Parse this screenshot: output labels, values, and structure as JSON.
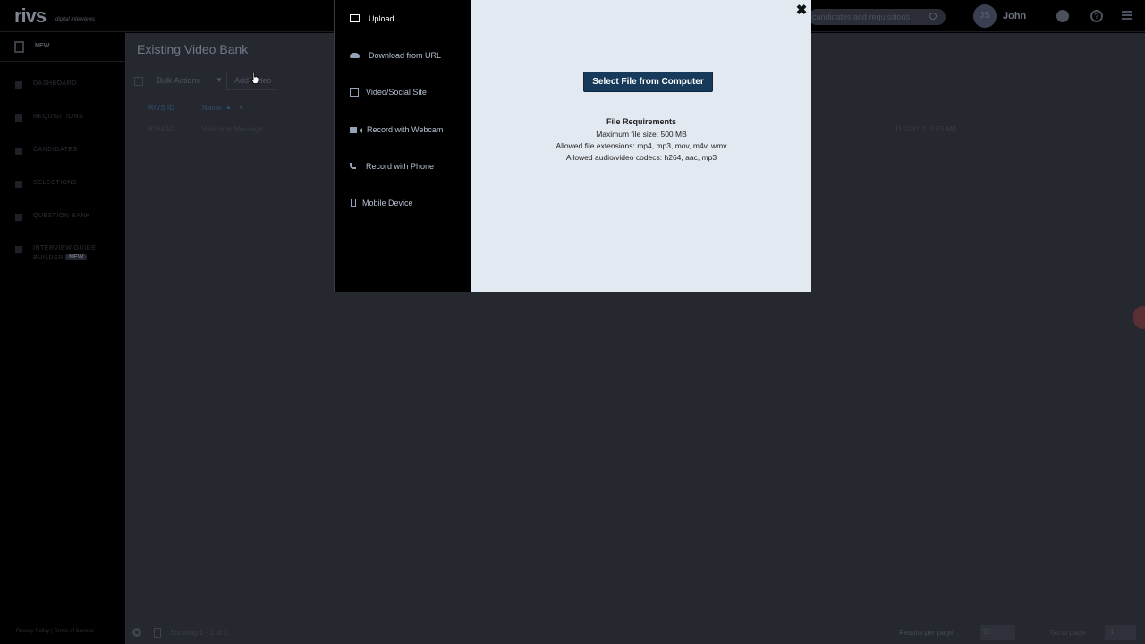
{
  "app": {
    "logo": "rivs",
    "logo_tagline": "digital interviews",
    "search_placeholder": "candidates and requisitions",
    "user": {
      "initials": "JS",
      "name": "John"
    }
  },
  "sidebar": {
    "new_label": "NEW",
    "items": [
      {
        "label": "DASHBOARD"
      },
      {
        "label": "REQUISITIONS"
      },
      {
        "label": "CANDIDATES"
      },
      {
        "label": "SELECTIONS"
      },
      {
        "label": "QUESTION BANK"
      },
      {
        "label": "INTERVIEW GUIDE",
        "label2": "BUILDER",
        "badge": "NEW"
      }
    ],
    "footer": "Privacy Policy | Terms of Service"
  },
  "main": {
    "title": "Existing Video Bank",
    "bulk_actions_label": "Bulk Actions",
    "add_button_label": "Add Video",
    "columns": {
      "id": "RIVS ID",
      "name": "Name"
    },
    "rows": [
      {
        "id": "8384341",
        "name": "Welcome Message",
        "date": "11/2/2017, 3:53 AM"
      }
    ],
    "pagination": {
      "showing": "Showing 1 - 1 of 1",
      "results_per_page_label": "Results per page",
      "results_per_page": "50",
      "go_to_page_label": "Go to page",
      "page": "1"
    }
  },
  "modal": {
    "nav": [
      {
        "label": "Upload",
        "icon": "laptop-icon",
        "active": true
      },
      {
        "label": "Download from URL",
        "icon": "cloud-icon"
      },
      {
        "label": "Video/Social Site",
        "icon": "social-icon"
      },
      {
        "label": "Record with Webcam",
        "icon": "webcam-icon"
      },
      {
        "label": "Record with Phone",
        "icon": "phone-icon"
      },
      {
        "label": "Mobile Device",
        "icon": "mobile-icon"
      }
    ],
    "select_button_label": "Select File from Computer",
    "requirements_title": "File Requirements",
    "requirements": [
      "Maximum file size: 500 MB",
      "Allowed file extensions: mp4, mp3, mov, m4v, wmv",
      "Allowed audio/video codecs: h264, aac, mp3"
    ],
    "close_symbol": "✖"
  },
  "colors": {
    "modal_bg": "#e3e9f1",
    "primary_button": "#17395a",
    "overlay_bg": "#262830"
  }
}
